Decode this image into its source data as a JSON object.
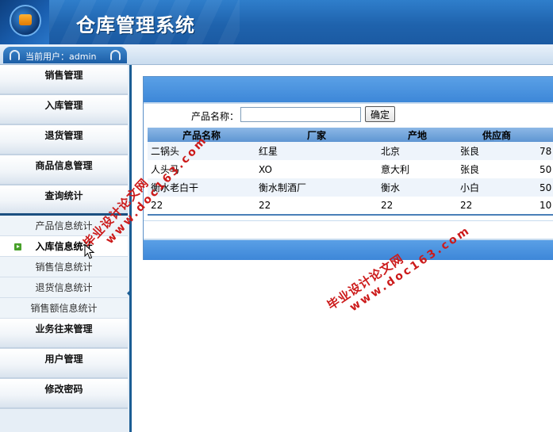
{
  "header": {
    "title": "仓库管理系统"
  },
  "userbar": {
    "label": "当前用户：",
    "username": "admin"
  },
  "sidebar": {
    "menus": [
      {
        "label": "销售管理"
      },
      {
        "label": "入库管理"
      },
      {
        "label": "退货管理"
      },
      {
        "label": "商品信息管理"
      },
      {
        "label": "查询统计"
      }
    ],
    "submenu": [
      {
        "label": "产品信息统计"
      },
      {
        "label": "入库信息统计"
      },
      {
        "label": "销售信息统计"
      },
      {
        "label": "退货信息统计"
      },
      {
        "label": "销售额信息统计"
      }
    ],
    "menus_after": [
      {
        "label": "业务往来管理"
      },
      {
        "label": "用户管理"
      },
      {
        "label": "修改密码"
      }
    ]
  },
  "search": {
    "label": "产品名称：",
    "value": "",
    "button": "确定"
  },
  "table": {
    "headers": [
      "产品名称",
      "厂家",
      "产地",
      "供应商",
      ""
    ],
    "rows": [
      [
        "二锅头",
        "红星",
        "北京",
        "张良",
        "78"
      ],
      [
        "人头马",
        "XO",
        "意大利",
        "张良",
        "50"
      ],
      [
        "衡水老白干",
        "衡水制酒厂",
        "衡水",
        "小白",
        "50"
      ],
      [
        "22",
        "22",
        "22",
        "22",
        "10"
      ]
    ]
  },
  "watermarks": [
    {
      "line1": "毕业设计论文网",
      "line2": "www.doc163.com"
    },
    {
      "line1": "毕业设计论文网",
      "line2": "www.doc163.com"
    }
  ],
  "colors": {
    "header": "#1f63ad",
    "panel_bar": "#3d87d8",
    "sidebar_border": "#1b5d94",
    "watermark": "#cc1a1a"
  }
}
